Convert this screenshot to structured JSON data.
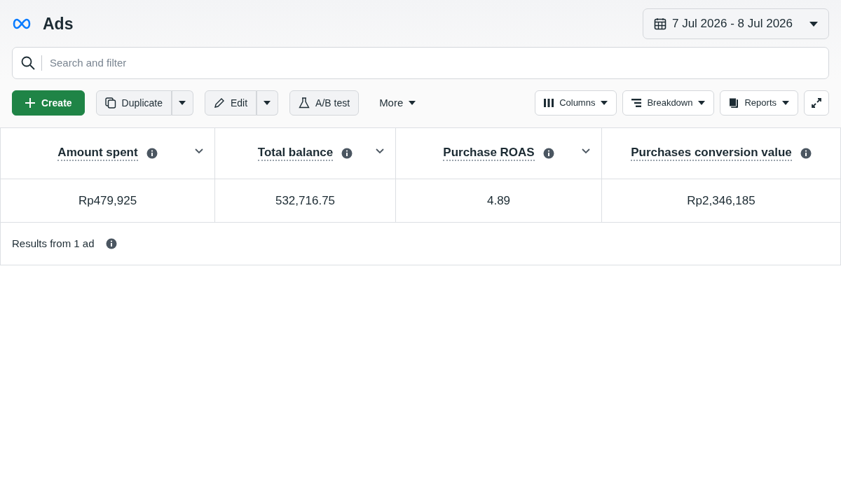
{
  "header": {
    "title": "Ads",
    "date_range": "7 Jul 2026 - 8 Jul 2026"
  },
  "search": {
    "placeholder": "Search and filter"
  },
  "toolbar_left": [
    {
      "kind": "primary",
      "label": "Create"
    },
    {
      "kind": "split",
      "label": "Duplicate"
    },
    {
      "kind": "split",
      "label": "Edit"
    },
    {
      "kind": "plain",
      "label": "A/B test"
    },
    {
      "kind": "menu",
      "label": "More"
    }
  ],
  "toolbar_right": [
    {
      "kind": "dropdown",
      "label": "Columns"
    },
    {
      "kind": "dropdown",
      "label": "Breakdown"
    },
    {
      "kind": "dropdown",
      "label": "Reports"
    },
    {
      "kind": "icon"
    }
  ],
  "table": {
    "columns": [
      {
        "label": "Amount spent",
        "sortable": true
      },
      {
        "label": "Total balance",
        "sortable": true
      },
      {
        "label": "Purchase ROAS",
        "sortable": true
      },
      {
        "label": "Purchases conversion value",
        "sortable": false
      }
    ],
    "rows": [
      [
        "Rp479,925",
        "532,716.75",
        "4.89",
        "Rp2,346,185"
      ]
    ],
    "footer": "Results from 1 ad"
  }
}
